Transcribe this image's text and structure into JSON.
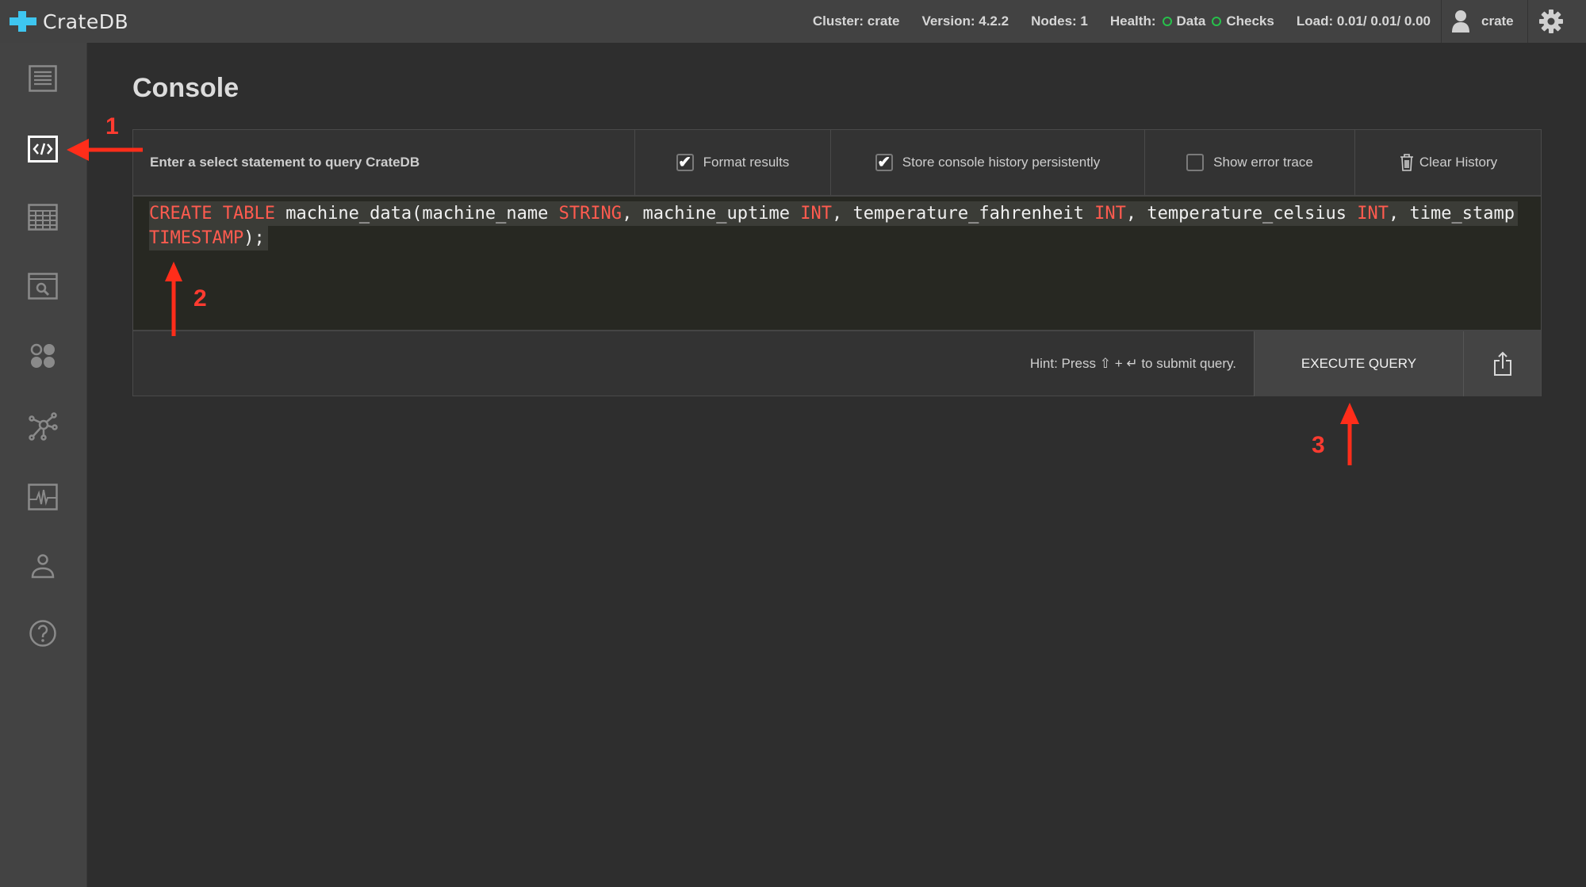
{
  "app": {
    "name": "CrateDB",
    "brand_color": "#3ec6f0"
  },
  "topbar": {
    "cluster": "Cluster: crate",
    "version": "Version: 4.2.2",
    "nodes": "Nodes: 1",
    "health_label": "Health:",
    "health_data": "Data",
    "health_checks": "Checks",
    "health_color": "#27c04b",
    "load": "Load: 0.01/ 0.01/ 0.00",
    "user": "crate"
  },
  "sidebar": {
    "items": [
      {
        "icon": "overview-icon",
        "active": false
      },
      {
        "icon": "console-icon",
        "active": true
      },
      {
        "icon": "tables-icon",
        "active": false
      },
      {
        "icon": "views-icon",
        "active": false
      },
      {
        "icon": "shards-icon",
        "active": false
      },
      {
        "icon": "cluster-icon",
        "active": false
      },
      {
        "icon": "monitoring-icon",
        "active": false
      },
      {
        "icon": "users-icon",
        "active": false
      },
      {
        "icon": "help-icon",
        "active": false
      }
    ]
  },
  "page": {
    "title": "Console"
  },
  "console": {
    "prompt": "Enter a select statement to query CrateDB",
    "format_results": {
      "label": "Format results",
      "checked": true
    },
    "store_history": {
      "label": "Store console history persistently",
      "checked": true
    },
    "show_error_trace": {
      "label": "Show error trace",
      "checked": false
    },
    "clear_history": "Clear History",
    "query_line1": [
      {
        "t": "CREATE TABLE",
        "kw": true
      },
      {
        "t": " machine_data(machine_name ",
        "kw": false
      },
      {
        "t": "STRING",
        "kw": true
      },
      {
        "t": ", machine_uptime ",
        "kw": false
      },
      {
        "t": "INT",
        "kw": true
      },
      {
        "t": ", temperature_fahrenheit ",
        "kw": false
      },
      {
        "t": "INT",
        "kw": true
      },
      {
        "t": ", temperature_celsius ",
        "kw": false
      },
      {
        "t": "INT",
        "kw": true
      },
      {
        "t": ", time_stamp",
        "kw": false
      }
    ],
    "query_line2": [
      {
        "t": "TIMESTAMP",
        "kw": true
      },
      {
        "t": ");",
        "kw": false
      }
    ],
    "hint": "Hint: Press ⇧ + ↵ to submit query.",
    "execute": "EXECUTE QUERY"
  },
  "annotations": {
    "a1": "1",
    "a2": "2",
    "a3": "3",
    "color": "#ff2d1a"
  }
}
